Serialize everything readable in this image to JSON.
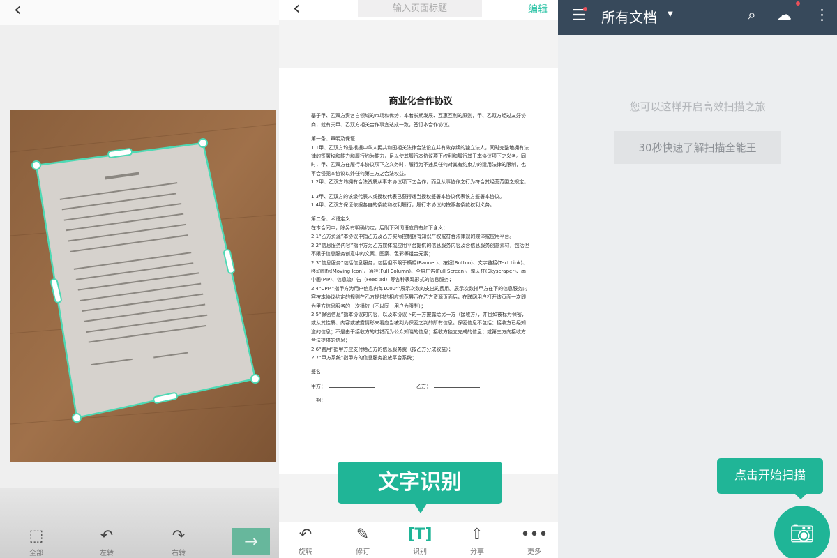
{
  "colors": {
    "accent": "#20b597",
    "header": "#37495b",
    "edit": "#2cc3a6"
  },
  "crop_screen": {
    "back_icon": "chevron-left-icon",
    "toolbar": [
      {
        "icon": "select-all-icon",
        "label": "全部"
      },
      {
        "icon": "rotate-left-icon",
        "label": "左转"
      },
      {
        "icon": "rotate-right-icon",
        "label": "右转"
      }
    ],
    "next_icon": "arrow-right-icon",
    "photo_doc_title": "商业化合作协议"
  },
  "preview_screen": {
    "title_placeholder": "输入页面标题",
    "edit_label": "编辑",
    "document": {
      "title": "商业化合作协议",
      "paragraphs": [
        "基于甲、乙双方资各自领域的市场和优势，本着长期发展、互惠互利的原则，甲、乙双方经过友好协商，就有关甲、乙双方相关合作事宜达成一致，签订本合作协议。",
        "第一条、声明及保证",
        "1.1甲、乙双方均是根据中华人民共和国相关法律合法设立并有效存续的独立法人，同时完整地拥有法律的签署权和能力和履行约为能力，足以使其履行本协议项下权利和履行其于本协议项下之义务。同时，甲、乙双方在履行本协议项下之义务时，履行为不违反任何对其有约束力的适用法律的限制，也不会侵犯本协议以外任何第三方之合法权益。",
        "1.2甲、乙双方均拥有合法资质从事本协议项下之合作，而且从事协作之行为符合其经营范围之规定。",
        "1.3甲、乙双方的该级代表人或授权代表已获得适当授权签署本协议代表该方签署本协议。",
        "1.4甲、乙双方保证依据各自的条款和权利履行，履行本协议的按照各条款权利义务。",
        "第二条、术语定义",
        "在本合同中，除另有明确约定，后附下列词语应具有如下含义：",
        "2.1“乙方资源”本协议中指乙方及乙方实际控制拥有知识产权或符合法律规的媒体或应用平台。",
        "2.2“信息服务内容”指甲方为乙方媒体或应用平台提供的信息服务内容及含信息服务创意素材，包括但不限于信息服务创意中的文案、图案、色彩等组合元素；",
        "2.3“信息服务”包括信息服务，包括但不限于横幅(Banner)、按钮(Button)、文字链接(Text Link)、移动图标(Moving Icon)、通栏(Full Column)、全屏广告(Full Screen)、擎天柱(Skyscraper)、画中画(PIP)、信息流广告（Feed ad）等各种表现形式的信息服务；",
        "2.4“CPM”指甲方为用户信息内每1000个展示次数的支出的费用。展示次数指甲方在下的信息服务内容按本协议约定的规则在乙方提供的相应规范展示在乙方资源页面后，在联网用户打开该页面一次即为甲方信息服务的一次播放（不以同一用户为限制）；",
        "2.5“保密信息”指本协议的内容，以及本协议下的一方披露给另一方（接收方），并且如被标为保密，或从其性质、内容或披露情形来看应当被判为保密之判的所有信息。保密信息不包括：接收方已经知道的信息；不是由于接收方的过错而为公众知晓的信息；接收方独立完成的信息；或第三方向接收方合法提供的信息；",
        "2.6“费用”指甲方应支付给乙方的信息服务费（按乙方分成收益）；",
        "2.7“甲方系统”指甲方的信息服务投放平台系统；"
      ],
      "sign_label": "签名",
      "party_a": "甲方：",
      "party_b": "乙方：",
      "date_label": "日期："
    },
    "ocr_tooltip": "文字识别",
    "toolbar": [
      {
        "icon": "rotate-icon",
        "label": "旋转"
      },
      {
        "icon": "pencil-icon",
        "label": "修订"
      },
      {
        "icon": "text-recognize-icon",
        "label": "识别"
      },
      {
        "icon": "share-icon",
        "label": "分享"
      },
      {
        "icon": "more-icon",
        "label": "更多"
      }
    ]
  },
  "home_screen": {
    "title": "所有文档",
    "hint": "您可以这样开启高效扫描之旅",
    "guide_button": "30秒快速了解扫描全能王",
    "scan_tooltip": "点击开始扫描"
  }
}
